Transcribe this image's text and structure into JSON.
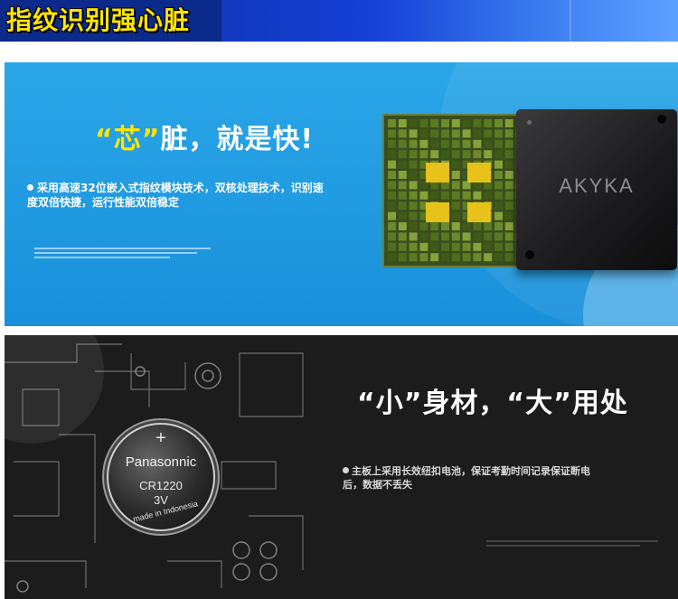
{
  "header": {
    "title": "指纹识别强心脏"
  },
  "chip_section": {
    "heading_q1": "“芯”",
    "heading_rest": "脏，就是快!",
    "bullet": "采用高速32位嵌入式指纹模块技术，双核处理技术，识别速度双倍快捷，运行性能双倍稳定",
    "chip_brand": "AKYKA"
  },
  "battery_section": {
    "heading": "“小”身材，“大”用处",
    "bullet": "主板上采用长效纽扣电池，保证考勤时间记录保证断电后，数据不丢失",
    "battery_plus": "+",
    "battery_brand": "Panasonnic",
    "battery_model": "CR1220",
    "battery_voltage": "3V",
    "battery_origin": "made in Indonesia"
  },
  "colors": {
    "header_dark": "#0b2a8c",
    "header_title": "#ffe600",
    "blue_panel": "#2aa6e8",
    "accent_yellow": "#ffe400",
    "dark_panel": "#1c1c1c"
  }
}
